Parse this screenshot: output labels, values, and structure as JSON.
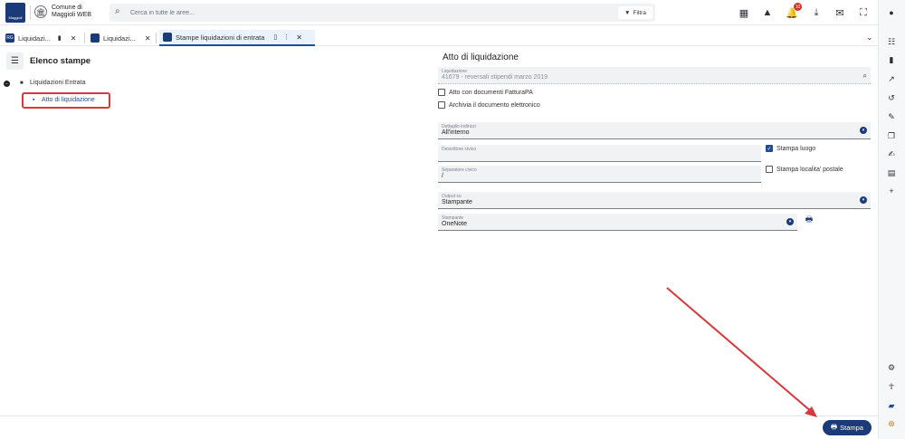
{
  "app": {
    "org_name_line1": "Comune di",
    "org_name_line2": "Maggioli WEB",
    "logo_text": "Maggioli"
  },
  "search": {
    "placeholder": "Cerca in tutte le aree...",
    "filter_label": "Filtra"
  },
  "notifications": {
    "count": "10"
  },
  "tabs": [
    {
      "label": "Liquidazi...",
      "icon_text": "RG"
    },
    {
      "label": "Liquidazi...",
      "icon_text": ""
    },
    {
      "label": "Stampe liquidazioni di entrata",
      "icon_text": ""
    }
  ],
  "left_panel": {
    "title": "Elenco stampe",
    "tree_root": "Liquidazioni Entrata",
    "tree_child": "Atto di liquidazione"
  },
  "form": {
    "title": "Atto di liquidazione",
    "liquidazione": {
      "label": "Liquidazione",
      "value": "41679 - reversali stipendi marzo 2019"
    },
    "chk_fatturapa": {
      "label": "Atto con documenti FatturaPA",
      "checked": false
    },
    "chk_archivia": {
      "label": "Archivia il documento elettronico",
      "checked": false
    },
    "dettaglio_indirizzi": {
      "label": "Dettaglio indirizzi",
      "value": "All'interno"
    },
    "descrittore_civico": {
      "label": "Descrittore civico",
      "value": ""
    },
    "separatore_civico": {
      "label": "Separatore civico",
      "value": "/"
    },
    "chk_stampa_luogo": {
      "label": "Stampa luogo",
      "checked": true
    },
    "chk_stampa_localita": {
      "label": "Stampa localita' postale",
      "checked": false
    },
    "output_su": {
      "label": "Output su",
      "value": "Stampante"
    },
    "stampante": {
      "label": "Stampante",
      "value": "OneNote"
    }
  },
  "footer": {
    "print_button": "Stampa"
  },
  "colors": {
    "primary": "#1b3a78",
    "highlight": "#d9383a",
    "accent": "#1f4d9a"
  },
  "icons": {
    "top_right": [
      "dashboard-icon",
      "warning-icon",
      "bell-icon",
      "download-icon",
      "mail-icon",
      "fullscreen-icon"
    ],
    "right_sidebar": [
      "user-icon",
      "list-icon",
      "book-icon",
      "trend-icon",
      "history-icon",
      "pin-icon",
      "copy-icon",
      "edit-document-icon",
      "pdf-icon",
      "plus-icon",
      "settings-icon",
      "accessibility-icon",
      "chat-icon",
      "support-icon"
    ]
  }
}
